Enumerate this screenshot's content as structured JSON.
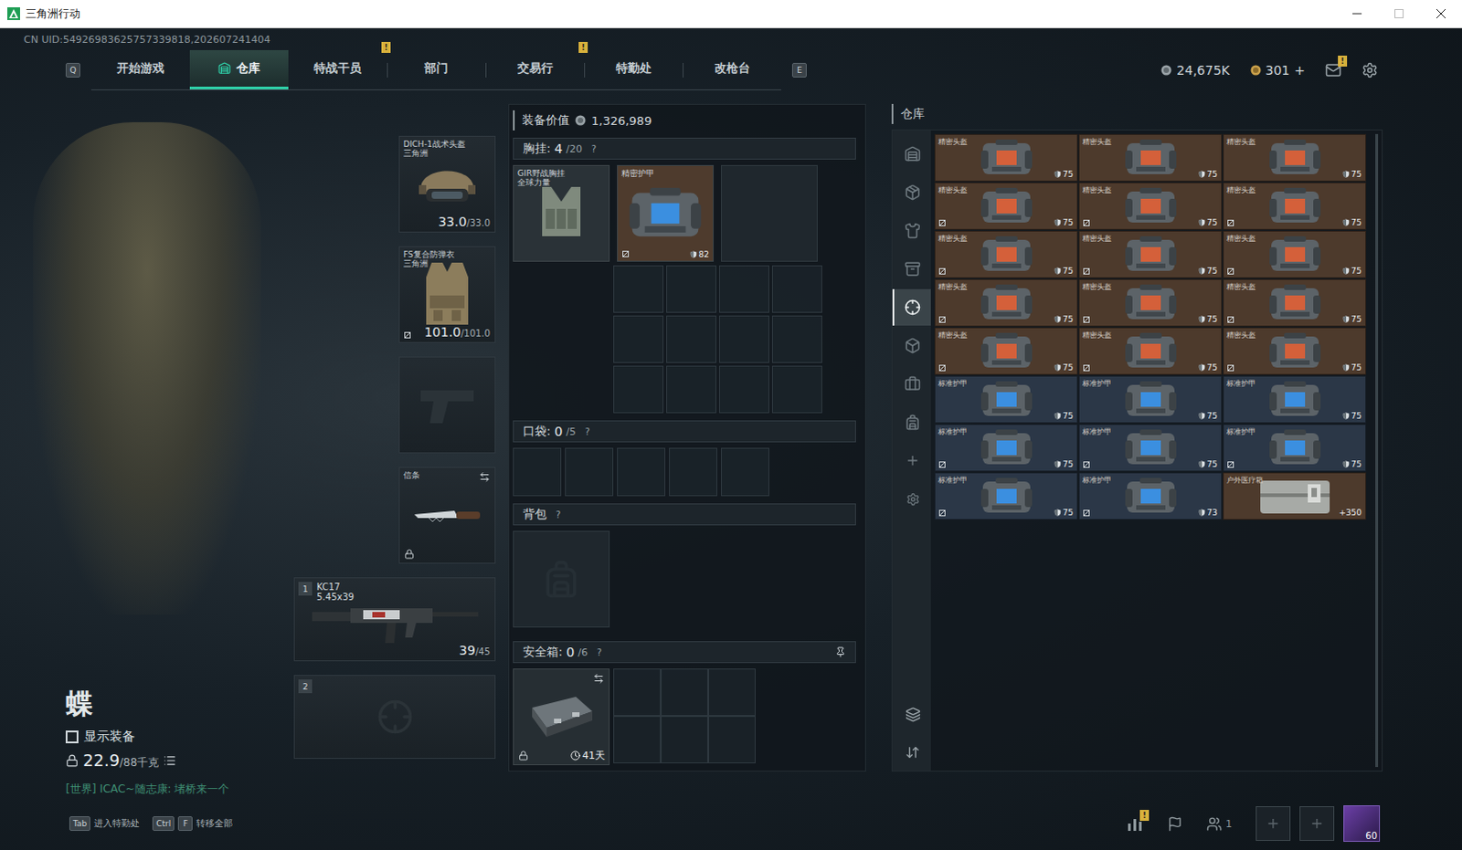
{
  "window": {
    "title": "三角洲行动"
  },
  "uid": "CN UID:54926983625757339818,202607241404",
  "nav": {
    "left_key": "Q",
    "right_key": "E",
    "tabs": [
      {
        "label": "开始游戏",
        "selected": false,
        "badge": ""
      },
      {
        "label": "仓库",
        "selected": true,
        "badge": ""
      },
      {
        "label": "特战干员",
        "selected": false,
        "badge": ""
      },
      {
        "label": "部门",
        "selected": false,
        "badge": "!"
      },
      {
        "label": "交易行",
        "selected": false,
        "badge": ""
      },
      {
        "label": "特勤处",
        "selected": false,
        "badge": "!"
      },
      {
        "label": "改枪台",
        "selected": false,
        "badge": ""
      }
    ]
  },
  "currency": {
    "coins": "24,675K",
    "tickets": "301",
    "add": "+",
    "mail_badge": "!"
  },
  "character": {
    "name": "蝶",
    "show_gear": {
      "label": "显示装备",
      "checked": false
    },
    "weight": "22.9",
    "weight_max": "/88千克",
    "chat": "[世界] ICAC~随志康: 堵桥来一个"
  },
  "equipment": {
    "helmet": {
      "name": "DICH-1战术头盔",
      "brand": "三角洲",
      "durability": "33.0",
      "durability_max": "/33.0"
    },
    "armor": {
      "name": "FS复合防弹衣",
      "brand": "三角洲",
      "durability": "101.0",
      "durability_max": "/101.0"
    },
    "pistol": {
      "empty": true
    },
    "melee": {
      "label": "信条",
      "locked": true
    },
    "weapons": [
      {
        "slot": "1",
        "name": "KC17",
        "ammo_type": "5.45x39",
        "ammo": "39",
        "ammo_max": "/45",
        "empty": false
      },
      {
        "slot": "2",
        "name": "",
        "ammo_type": "",
        "ammo": "",
        "ammo_max": "",
        "empty": true
      }
    ]
  },
  "loadout": {
    "value_label": "装备价值",
    "value": "1,326,989",
    "chest": {
      "label": "胸挂:",
      "count": "4",
      "capacity": "/20",
      "help": "?",
      "rig": {
        "name": "GIR野战胸挂",
        "brand": "全球力量"
      },
      "items": [
        {
          "name": "精密护甲",
          "value": "82",
          "color": "#4e3b2d",
          "marked": true
        }
      ]
    },
    "pockets": {
      "label": "口袋:",
      "count": "0",
      "capacity": "/5",
      "help": "?",
      "slots": [
        {
          "filled": false
        },
        {
          "filled": false
        },
        {
          "filled": false
        },
        {
          "filled": false
        },
        {
          "filled": false
        }
      ]
    },
    "backpack": {
      "label": "背包",
      "help": "?"
    },
    "safe": {
      "label": "安全箱:",
      "count": "0",
      "capacity": "/6",
      "help": "?",
      "expires": "41天",
      "locked": true
    }
  },
  "warehouse": {
    "title": "仓库",
    "sidebar": [
      {
        "selected": false
      },
      {
        "selected": false
      },
      {
        "selected": false
      },
      {
        "selected": false
      },
      {
        "selected": true
      },
      {
        "selected": false
      },
      {
        "selected": false
      },
      {
        "selected": false
      }
    ],
    "items": [
      {
        "name": "精密头盔",
        "value": "75",
        "kind": "helmet",
        "color": "#4d3a2c",
        "marked": false
      },
      {
        "name": "精密头盔",
        "value": "75",
        "kind": "helmet",
        "color": "#4d3a2c",
        "marked": false
      },
      {
        "name": "精密头盔",
        "value": "75",
        "kind": "helmet",
        "color": "#4d3a2c",
        "marked": false
      },
      {
        "name": "精密头盔",
        "value": "75",
        "kind": "helmet",
        "color": "#4d3a2c",
        "marked": true
      },
      {
        "name": "精密头盔",
        "value": "75",
        "kind": "helmet",
        "color": "#4d3a2c",
        "marked": true
      },
      {
        "name": "精密头盔",
        "value": "75",
        "kind": "helmet",
        "color": "#4d3a2c",
        "marked": true
      },
      {
        "name": "精密头盔",
        "value": "75",
        "kind": "helmet",
        "color": "#4d3a2c",
        "marked": true
      },
      {
        "name": "精密头盔",
        "value": "75",
        "kind": "helmet",
        "color": "#4d3a2c",
        "marked": true
      },
      {
        "name": "精密头盔",
        "value": "75",
        "kind": "helmet",
        "color": "#4d3a2c",
        "marked": true
      },
      {
        "name": "精密头盔",
        "value": "75",
        "kind": "helmet",
        "color": "#4d3a2c",
        "marked": true
      },
      {
        "name": "精密头盔",
        "value": "75",
        "kind": "helmet",
        "color": "#4d3a2c",
        "marked": true
      },
      {
        "name": "精密头盔",
        "value": "75",
        "kind": "helmet",
        "color": "#4d3a2c",
        "marked": true
      },
      {
        "name": "精密头盔",
        "value": "75",
        "kind": "helmet",
        "color": "#4d3a2c",
        "marked": true
      },
      {
        "name": "精密头盔",
        "value": "75",
        "kind": "helmet",
        "color": "#4d3a2c",
        "marked": true
      },
      {
        "name": "精密头盔",
        "value": "75",
        "kind": "helmet",
        "color": "#4d3a2c",
        "marked": true
      },
      {
        "name": "标准护甲",
        "value": "75",
        "kind": "armor",
        "color": "#2b3747",
        "marked": false
      },
      {
        "name": "标准护甲",
        "value": "75",
        "kind": "armor",
        "color": "#2b3747",
        "marked": false
      },
      {
        "name": "标准护甲",
        "value": "75",
        "kind": "armor",
        "color": "#2b3747",
        "marked": false
      },
      {
        "name": "标准护甲",
        "value": "75",
        "kind": "armor",
        "color": "#2b3747",
        "marked": true
      },
      {
        "name": "标准护甲",
        "value": "75",
        "kind": "armor",
        "color": "#2b3747",
        "marked": true
      },
      {
        "name": "标准护甲",
        "value": "75",
        "kind": "armor",
        "color": "#2b3747",
        "marked": true
      },
      {
        "name": "标准护甲",
        "value": "75",
        "kind": "armor",
        "color": "#2b3747",
        "marked": true
      },
      {
        "name": "标准护甲",
        "value": "73",
        "kind": "armor",
        "color": "#2b3747",
        "marked": true
      },
      {
        "name": "户外医疗箱",
        "value": "+350",
        "kind": "medkit",
        "color": "#4d3a2c",
        "marked": false
      }
    ]
  },
  "bottom_bar": {
    "hints": [
      {
        "keys": [
          "Tab"
        ],
        "label": "进入特勤处"
      },
      {
        "keys": [
          "Ctrl",
          "F"
        ],
        "label": "转移全部"
      }
    ],
    "stats_badge": "!",
    "friends": "1",
    "level": "60"
  }
}
